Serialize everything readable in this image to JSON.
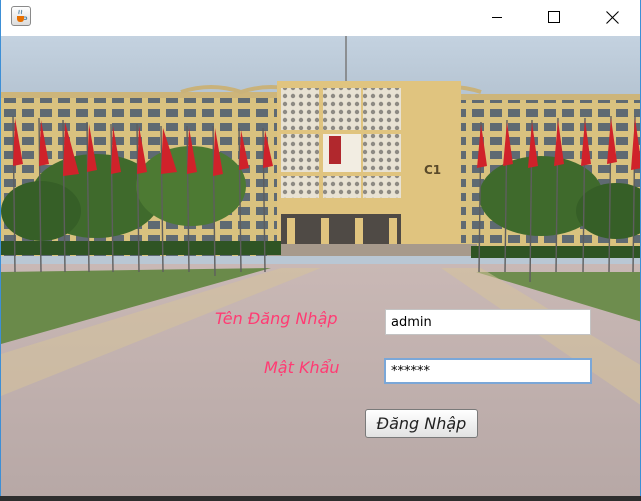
{
  "window": {
    "app_icon": "java-coffee-cup-icon",
    "controls": [
      "minimize-icon",
      "maximize-icon",
      "close-icon"
    ]
  },
  "background": {
    "subject": "building-photo",
    "building_sign": "C1"
  },
  "form": {
    "username_label": "Tên Đăng Nhập",
    "username_value": "admin",
    "password_label": "Mật Khẩu",
    "password_value": "******",
    "login_button_label": "Đăng Nhập"
  },
  "colors": {
    "label_color": "#ff3b73",
    "focus_border": "#7aa7d8",
    "window_border": "#3d8fd6"
  }
}
